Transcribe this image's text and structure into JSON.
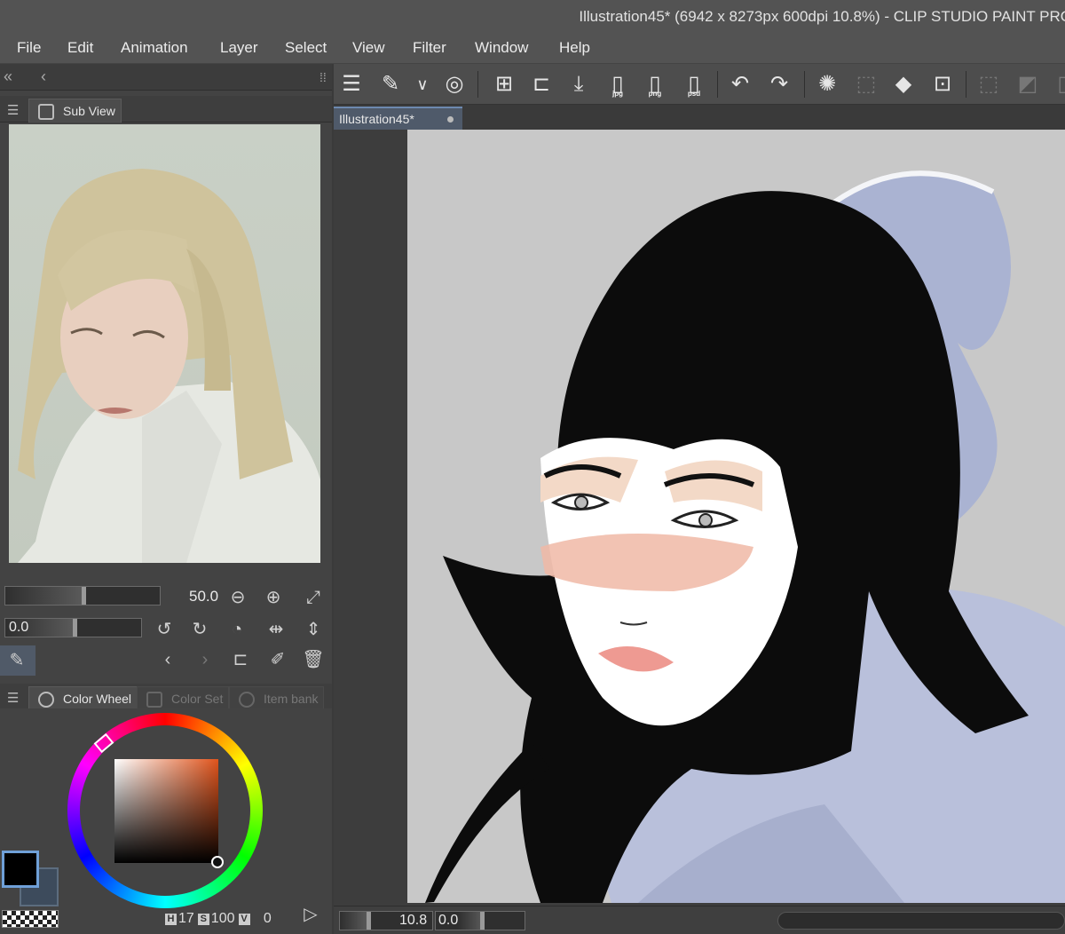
{
  "titlebar": {
    "title": "Illustration45* (6942 x 8273px 600dpi 10.8%)  - CLIP STUDIO PAINT PRO"
  },
  "menu": [
    "File",
    "Edit",
    "Animation",
    "Layer",
    "Select",
    "View",
    "Filter",
    "Window",
    "Help"
  ],
  "subview": {
    "tab_label": "Sub View",
    "zoom_value": "50.0",
    "rotate_value": "0.0"
  },
  "color_panel": {
    "tabs": [
      "Color Wheel",
      "Color Set",
      "Item bank"
    ],
    "h_label": "H",
    "h_value": "17",
    "s_label": "S",
    "s_value": "100",
    "v_label": "V",
    "v_value": "0",
    "main_color": "#000000",
    "sub_color": "#3d4b5c"
  },
  "toolbar": {
    "icons": [
      "menu-icon",
      "canvas-icon",
      "chevron-down-icon",
      "cloud-icon",
      "new-file-icon",
      "open-folder-icon",
      "save-icon",
      "export-jpg-icon",
      "export-png-icon",
      "export-psd-icon",
      "undo-icon",
      "redo-icon",
      "loading-icon",
      "select-all-icon",
      "fill-icon",
      "transform-icon",
      "hide-selection-icon",
      "selection-edge-icon",
      "more-icon"
    ],
    "jpg_label": "jpg",
    "png_label": "png",
    "psd_label": "psd"
  },
  "document": {
    "tab_label": "Illustration45*",
    "zoom_value": "10.8",
    "rotate_value": "0.0"
  }
}
